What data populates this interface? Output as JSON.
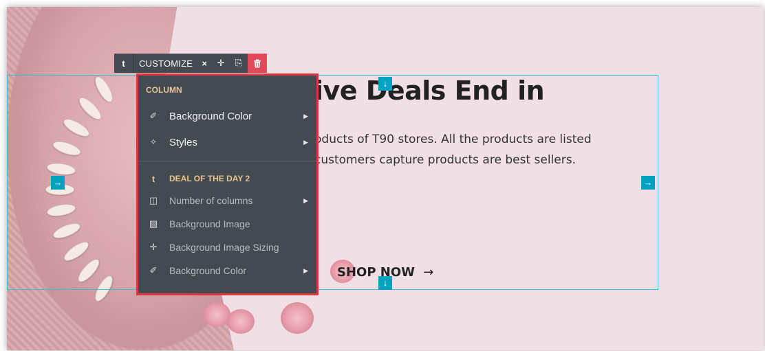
{
  "colors": {
    "accent_outline": "#2dc2d6",
    "handle": "#00a3bf",
    "toolbar_bg": "#444a52",
    "delete_bg": "#e2475a",
    "menu_highlight_border": "#e0353f",
    "section_title": "#e9c38f",
    "page_bg": "#f0e0e5"
  },
  "banner": {
    "headline": "ive Deals End in",
    "description": "oducts of T90 stores. All the products are listed customers capture products are best sellers.",
    "shop_now": "SHOP NOW",
    "shop_arrow": "→"
  },
  "toolbar": {
    "type_icon": "t",
    "label": "CUSTOMIZE",
    "close": "×",
    "move": "✛",
    "duplicate": "⎘",
    "delete": "🗑"
  },
  "menu": {
    "section_title": "COLUMN",
    "items": [
      {
        "label": "Background Color",
        "icon": "eyedropper-icon",
        "glyph": "✐",
        "submenu": true
      },
      {
        "label": "Styles",
        "icon": "magic-wand-icon",
        "glyph": "✧",
        "submenu": true
      }
    ],
    "deal": {
      "icon": "t",
      "title": "DEAL OF THE DAY 2"
    },
    "sub_items": [
      {
        "label": "Number of columns",
        "icon": "columns-icon",
        "glyph": "◫",
        "submenu": true
      },
      {
        "label": "Background Image",
        "icon": "image-icon",
        "glyph": "▨",
        "submenu": false
      },
      {
        "label": "Background Image Sizing",
        "icon": "arrows-icon",
        "glyph": "✛",
        "submenu": false
      },
      {
        "label": "Background Color",
        "icon": "eyedropper-icon",
        "glyph": "✐",
        "submenu": true
      }
    ],
    "submenu_arrow": "▶"
  },
  "handles": {
    "down": "🡇",
    "right": "🡆"
  }
}
